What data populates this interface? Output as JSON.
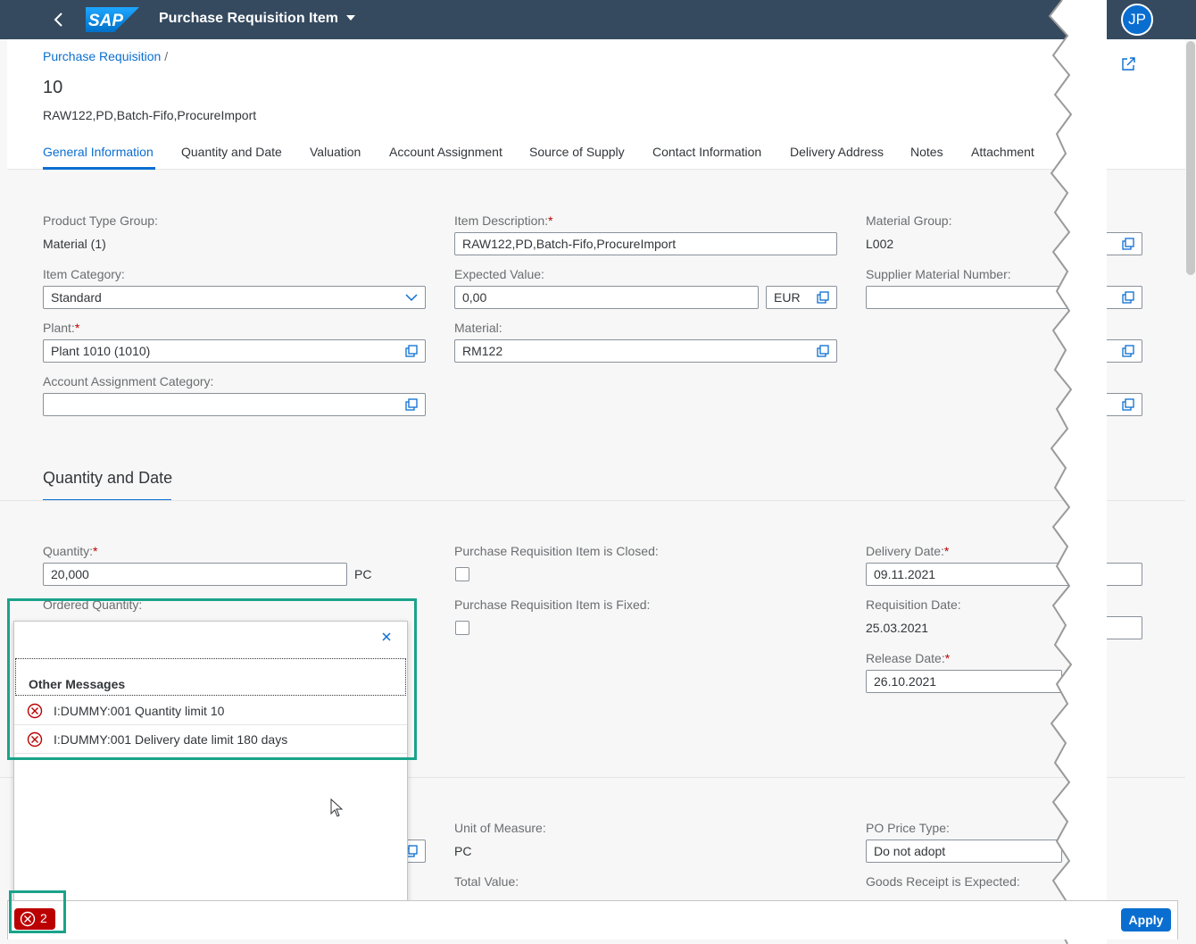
{
  "shell": {
    "app_title": "Purchase Requisition Item",
    "avatar_initials": "JP",
    "logo_text": "SAP"
  },
  "header": {
    "breadcrumb": "Purchase Requisition",
    "breadcrumb_sep": "/",
    "title": "10",
    "subtitle": "RAW122,PD,Batch-Fifo,ProcureImport"
  },
  "tabs": [
    {
      "label": "General Information"
    },
    {
      "label": "Quantity and Date"
    },
    {
      "label": "Valuation"
    },
    {
      "label": "Account Assignment"
    },
    {
      "label": "Source of Supply"
    },
    {
      "label": "Contact Information"
    },
    {
      "label": "Delivery Address"
    },
    {
      "label": "Notes"
    },
    {
      "label": "Attachment"
    }
  ],
  "general": {
    "product_type_group_label": "Product Type Group:",
    "product_type_group_value": "Material (1)",
    "item_category_label": "Item Category:",
    "item_category_value": "Standard",
    "plant_label": "Plant:",
    "plant_value": "Plant 1010 (1010)",
    "aac_label": "Account Assignment Category:",
    "aac_value": "",
    "item_desc_label": "Item Description:",
    "item_desc_value": "RAW122,PD,Batch-Fifo,ProcureImport",
    "expected_value_label": "Expected Value:",
    "expected_value_value": "0,00",
    "currency": "EUR",
    "material_label": "Material:",
    "material_value": "RM122",
    "material_group_label": "Material Group:",
    "material_group_value": "L002",
    "supplier_material_label": "Supplier Material Number:",
    "supplier_material_value": "",
    "required_mark": "*"
  },
  "qty_section": {
    "title": "Quantity and Date",
    "quantity_label": "Quantity:",
    "quantity_value": "20,000",
    "quantity_unit": "PC",
    "ordered_quantity_label": "Ordered Quantity:",
    "closed_label": "Purchase Requisition Item is Closed:",
    "fixed_label": "Purchase Requisition Item is Fixed:",
    "delivery_date_label": "Delivery Date:",
    "delivery_date_value": "09.11.2021",
    "requisition_date_label": "Requisition Date:",
    "requisition_date_value": "25.03.2021",
    "release_date_label": "Release Date:",
    "release_date_value": "26.10.2021"
  },
  "valuation": {
    "uom_label": "Unit of Measure:",
    "uom_value": "PC",
    "total_value_label": "Total Value:",
    "po_price_type_label": "PO Price Type:",
    "po_price_type_value": "Do not adopt",
    "gr_expected_label": "Goods Receipt is Expected:"
  },
  "message_popover": {
    "group_title": "Other Messages",
    "messages": [
      {
        "text": "I:DUMMY:001 Quantity limit 10"
      },
      {
        "text": "I:DUMMY:001 Delivery date limit 180 days"
      }
    ]
  },
  "footer": {
    "error_count": "2",
    "apply_label": "Apply"
  },
  "colors": {
    "shell": "#354a5f",
    "brand": "#0a6ed1",
    "error": "#bb0000",
    "highlight": "#1aa38a"
  }
}
